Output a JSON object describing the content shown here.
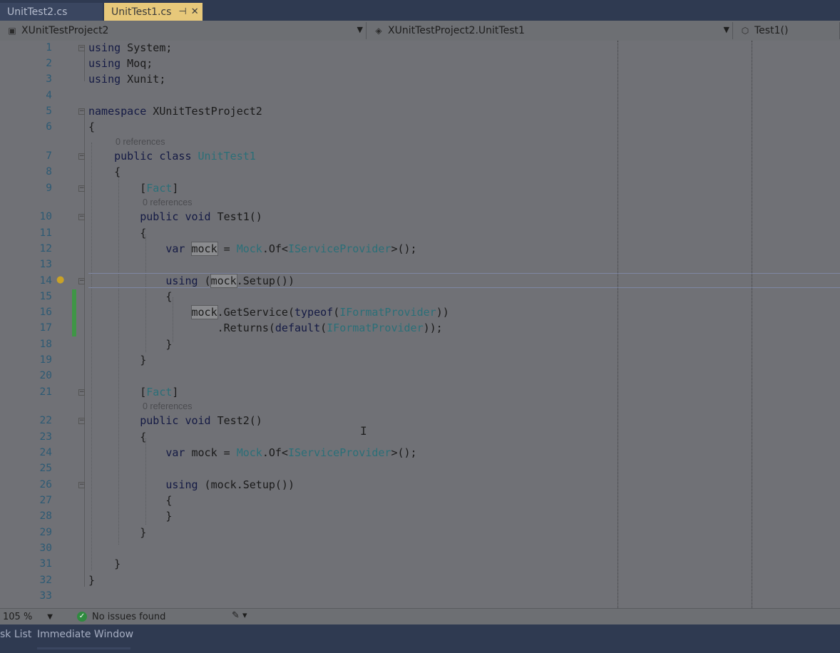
{
  "tabs": [
    {
      "label": "UnitTest2.cs"
    },
    {
      "label": "UnitTest1.cs",
      "active": true
    }
  ],
  "navbar": {
    "project": "XUnitTestProject2",
    "class": "XUnitTestProject2.UnitTest1",
    "member": "Test1()"
  },
  "editor": {
    "codelens": "0 references",
    "lines": [
      {
        "n": "1"
      },
      {
        "n": "2"
      },
      {
        "n": "3"
      },
      {
        "n": "4"
      },
      {
        "n": "5"
      },
      {
        "n": "6"
      },
      {
        "n": "7"
      },
      {
        "n": "8"
      },
      {
        "n": "9"
      },
      {
        "n": "10"
      },
      {
        "n": "11"
      },
      {
        "n": "12"
      },
      {
        "n": "13"
      },
      {
        "n": "14"
      },
      {
        "n": "15"
      },
      {
        "n": "16"
      },
      {
        "n": "17"
      },
      {
        "n": "18"
      },
      {
        "n": "19"
      },
      {
        "n": "20"
      },
      {
        "n": "21"
      },
      {
        "n": "22"
      },
      {
        "n": "23"
      },
      {
        "n": "24"
      },
      {
        "n": "25"
      },
      {
        "n": "26"
      },
      {
        "n": "27"
      },
      {
        "n": "28"
      },
      {
        "n": "29"
      },
      {
        "n": "30"
      },
      {
        "n": "31"
      },
      {
        "n": "32"
      },
      {
        "n": "33"
      }
    ]
  },
  "statusbar": {
    "zoom": "105 %",
    "issues": "No issues found"
  },
  "bottom_tabs": {
    "task_list": "sk List",
    "immediate": "Immediate Window"
  },
  "colors": {
    "active_tab": "#e7c87a",
    "background": "#2f3a51",
    "editor_bg": "#707176",
    "change_bar": "#3f9646"
  }
}
